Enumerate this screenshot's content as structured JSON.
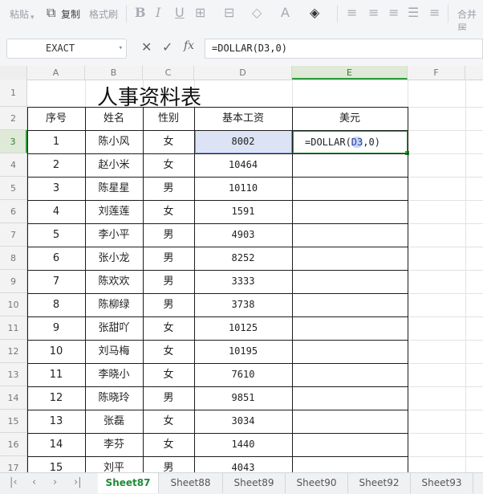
{
  "toolbar": {
    "paste_label": "粘贴",
    "copy_label": "复制",
    "format_painter_label": "格式刷",
    "merge_label": "合并居"
  },
  "formula_bar": {
    "name_box": "EXACT",
    "fx_label": "fx",
    "formula": "=DOLLAR(D3,0)"
  },
  "columns": [
    "A",
    "B",
    "C",
    "D",
    "E",
    "F"
  ],
  "rows": [
    "1",
    "2",
    "3",
    "4",
    "5",
    "6",
    "7",
    "8",
    "9",
    "10",
    "11",
    "12",
    "13",
    "14",
    "15",
    "16",
    "17"
  ],
  "sheet": {
    "title": "人事资料表",
    "headers": [
      "序号",
      "姓名",
      "性别",
      "基本工资",
      "美元"
    ],
    "data": [
      [
        "1",
        "陈小风",
        "女",
        "8002"
      ],
      [
        "2",
        "赵小米",
        "女",
        "10464"
      ],
      [
        "3",
        "陈星星",
        "男",
        "10110"
      ],
      [
        "4",
        "刘莲莲",
        "女",
        "1591"
      ],
      [
        "5",
        "李小平",
        "男",
        "4903"
      ],
      [
        "6",
        "张小龙",
        "男",
        "8252"
      ],
      [
        "7",
        "陈欢欢",
        "男",
        "3333"
      ],
      [
        "8",
        "陈柳绿",
        "男",
        "3738"
      ],
      [
        "9",
        "张甜吖",
        "女",
        "10125"
      ],
      [
        "10",
        "刘马梅",
        "女",
        "10195"
      ],
      [
        "11",
        "李晓小",
        "女",
        "7610"
      ],
      [
        "12",
        "陈晓玲",
        "男",
        "9851"
      ],
      [
        "13",
        "张磊",
        "女",
        "3034"
      ],
      [
        "14",
        "李芬",
        "女",
        "1440"
      ],
      [
        "15",
        "刘平",
        "男",
        "4043"
      ]
    ],
    "editing_cell": "=DOLLAR(D3,0)"
  },
  "sheet_tabs": [
    "Sheet87",
    "Sheet88",
    "Sheet89",
    "Sheet90",
    "Sheet92",
    "Sheet93"
  ],
  "active_sheet": "Sheet87",
  "colors": {
    "accent_green": "#2e9a3e",
    "selection_blue": "#dbe3f4"
  }
}
